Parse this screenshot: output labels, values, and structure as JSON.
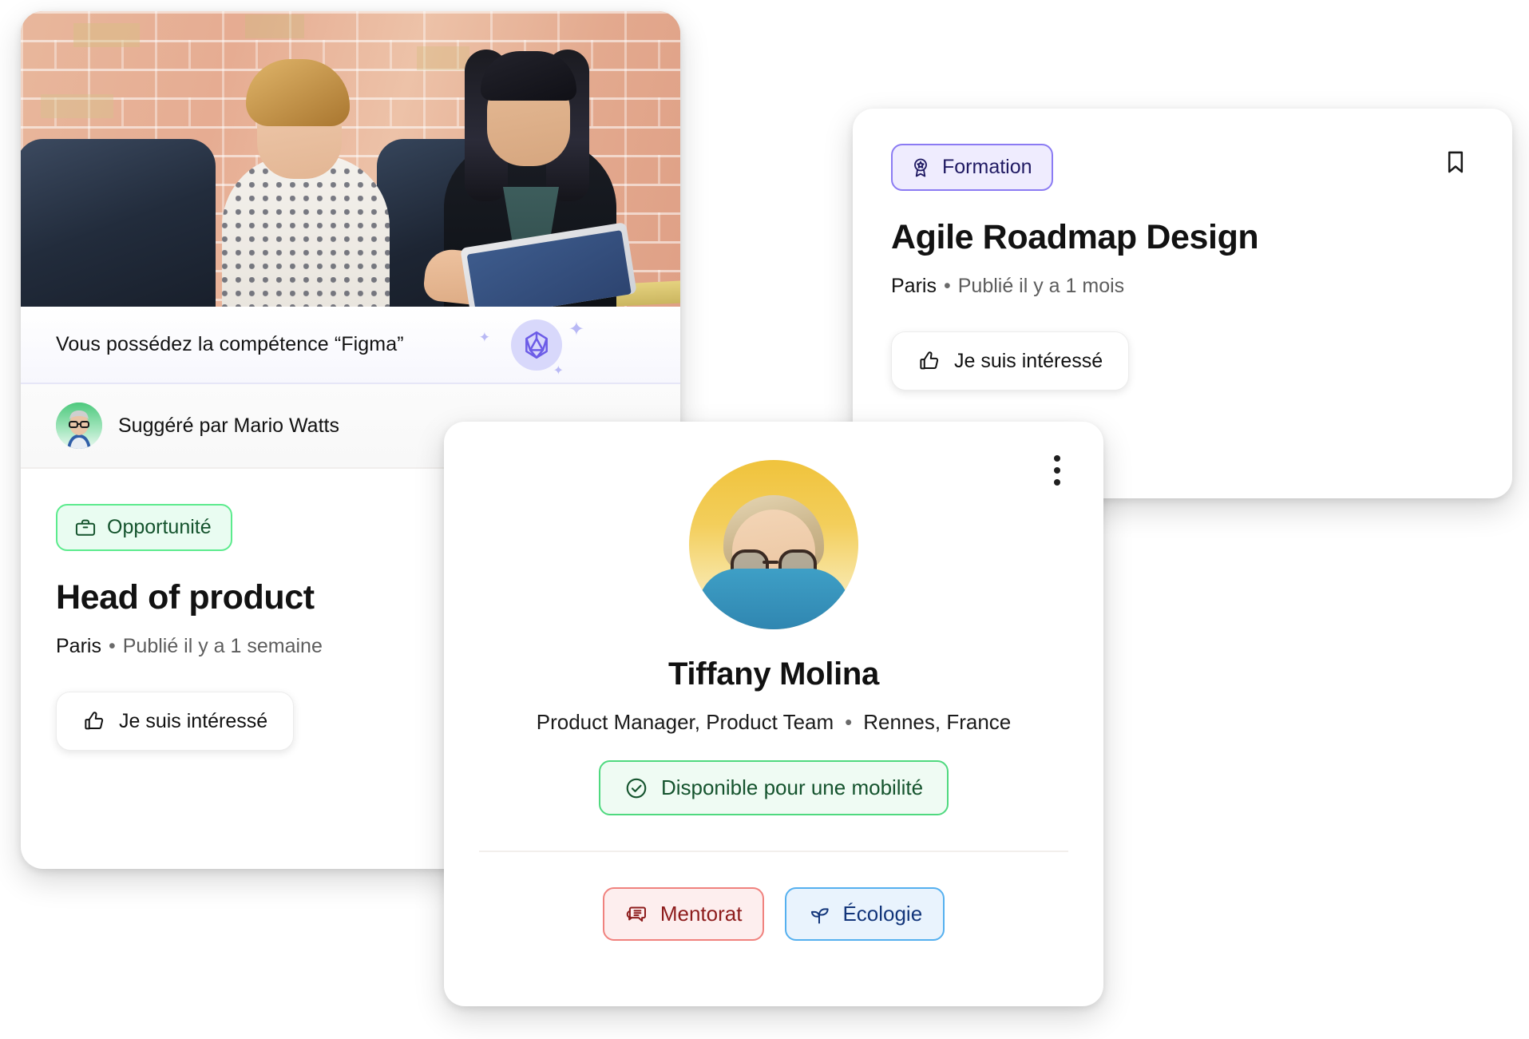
{
  "opportunity_card": {
    "hero_image_alt": "Two women in a meeting at a table against a brick wall",
    "skill": {
      "text": "Vous possédez la compétence “Figma”",
      "icon": "gem-icon",
      "sparkle_icon": "sparkle-icon"
    },
    "suggested_by": {
      "text": "Suggéré par Mario Watts",
      "avatar": "avatar-mario-watts"
    },
    "badge": {
      "label": "Opportunité",
      "icon": "briefcase-icon",
      "bg": "#e9fcf1",
      "border": "#5ceb8d",
      "text_color": "#14532d"
    },
    "title": "Head of product",
    "meta": {
      "location": "Paris",
      "separator": "•",
      "published": "Publié il y a 1 semaine"
    },
    "action": {
      "label": "Je suis intéressé",
      "icon": "thumbs-up-icon"
    }
  },
  "formation_card": {
    "badge": {
      "label": "Formation",
      "icon": "award-medal-icon",
      "bg": "#efecfe",
      "border": "#8b7bf3",
      "text_color": "#201a63"
    },
    "bookmark_icon": "bookmark-icon",
    "title": "Agile Roadmap Design",
    "meta": {
      "location": "Paris",
      "separator": "•",
      "published": "Publié il y a 1 mois"
    },
    "action": {
      "label": "Je suis intéressé",
      "icon": "thumbs-up-icon"
    }
  },
  "profile_card": {
    "menu_icon": "kebab-menu-icon",
    "avatar": "avatar-tiffany-molina",
    "name": "Tiffany Molina",
    "role": "Product Manager, Product  Team",
    "separator": "•",
    "location": "Rennes, France",
    "status": {
      "label": "Disponible pour une mobilité",
      "icon": "check-circle-icon",
      "bg": "#effbf3",
      "border": "#4fd97f",
      "text_color": "#14532d"
    },
    "tags": [
      {
        "label": "Mentorat",
        "icon": "chat-bubbles-icon",
        "bg": "#fdeeee",
        "border": "#f0827e",
        "text_color": "#8d1c1c"
      },
      {
        "label": "Écologie",
        "icon": "plant-leaf-icon",
        "bg": "#e9f3fd",
        "border": "#55b0ef",
        "text_color": "#12357a"
      }
    ]
  }
}
